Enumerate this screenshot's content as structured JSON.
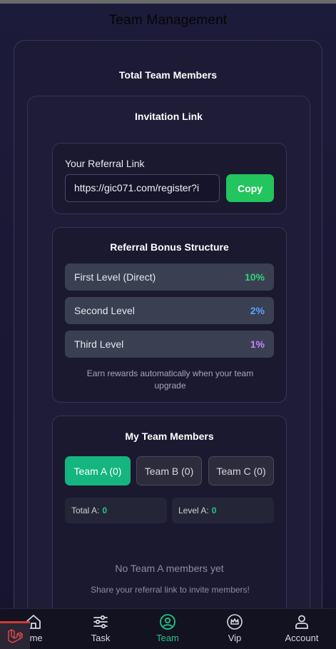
{
  "page": {
    "title": "Team Management"
  },
  "summary": {
    "heading": "Total Team Members"
  },
  "invitation": {
    "heading": "Invitation Link",
    "referral_label": "Your Referral Link",
    "referral_value": "https://gic071.com/register?i",
    "copy_label": "Copy"
  },
  "bonus": {
    "heading": "Referral Bonus Structure",
    "levels": [
      {
        "label": "First Level (Direct)",
        "percent": "10%",
        "color": "#34d27a"
      },
      {
        "label": "Second Level",
        "percent": "2%",
        "color": "#5ea2ff"
      },
      {
        "label": "Third Level",
        "percent": "1%",
        "color": "#c784ff"
      }
    ],
    "note": "Earn rewards automatically when your team upgrade"
  },
  "members": {
    "heading": "My Team Members",
    "tabs": [
      {
        "label": "Team A (0)",
        "active": true
      },
      {
        "label": "Team B (0)",
        "active": false
      },
      {
        "label": "Team C (0)",
        "active": false
      }
    ],
    "stats": [
      {
        "label": "Total A:",
        "value": "0"
      },
      {
        "label": "Level A:",
        "value": "0"
      }
    ],
    "empty_title": "No Team A members yet",
    "empty_sub": "Share your referral link to invite members!"
  },
  "nav": {
    "items": [
      {
        "label": "ome",
        "icon": "home-icon"
      },
      {
        "label": "Task",
        "icon": "sliders-icon"
      },
      {
        "label": "Team",
        "icon": "user-circle-icon",
        "active": true
      },
      {
        "label": "Vip",
        "icon": "crown-icon"
      },
      {
        "label": "Account",
        "icon": "user-icon"
      }
    ]
  },
  "colors": {
    "accent": "#22c55e",
    "team_active": "#15b57f",
    "nav_active": "#22c587"
  }
}
